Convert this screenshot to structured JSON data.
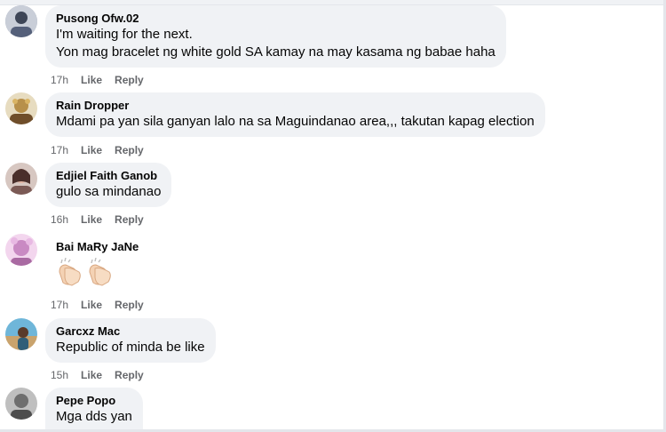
{
  "comments": [
    {
      "name": "Pusong Ofw.02",
      "lines": [
        "I'm waiting for the next.",
        "Yon mag bracelet ng white gold SA kamay na may kasama ng babae haha"
      ],
      "time": "17h",
      "like": "Like",
      "reply": "Reply",
      "avatar_color": "#9aa4b5"
    },
    {
      "name": "Rain Dropper",
      "lines": [
        "Mdami pa yan sila ganyan lalo na sa Maguindanao area,,, takutan kapag election"
      ],
      "time": "17h",
      "like": "Like",
      "reply": "Reply",
      "avatar_color": "#b99b59"
    },
    {
      "name": "Edjiel Faith Ganob",
      "lines": [
        "gulo sa mindanao"
      ],
      "time": "16h",
      "like": "Like",
      "reply": "Reply",
      "avatar_color": "#7b5a55"
    },
    {
      "name": "Bai MaRy JaNe",
      "emoji": [
        "clapping-hands",
        "clapping-hands"
      ],
      "time": "17h",
      "like": "Like",
      "reply": "Reply",
      "avatar_color": "#d8a2d0"
    },
    {
      "name": "Garcxz Mac",
      "lines": [
        "Republic of minda be like"
      ],
      "time": "15h",
      "like": "Like",
      "reply": "Reply",
      "avatar_color": "#5e9ab0"
    },
    {
      "name": "Pepe Popo",
      "lines": [
        "Mga dds yan"
      ],
      "avatar_color": "#8d8d8d"
    }
  ]
}
